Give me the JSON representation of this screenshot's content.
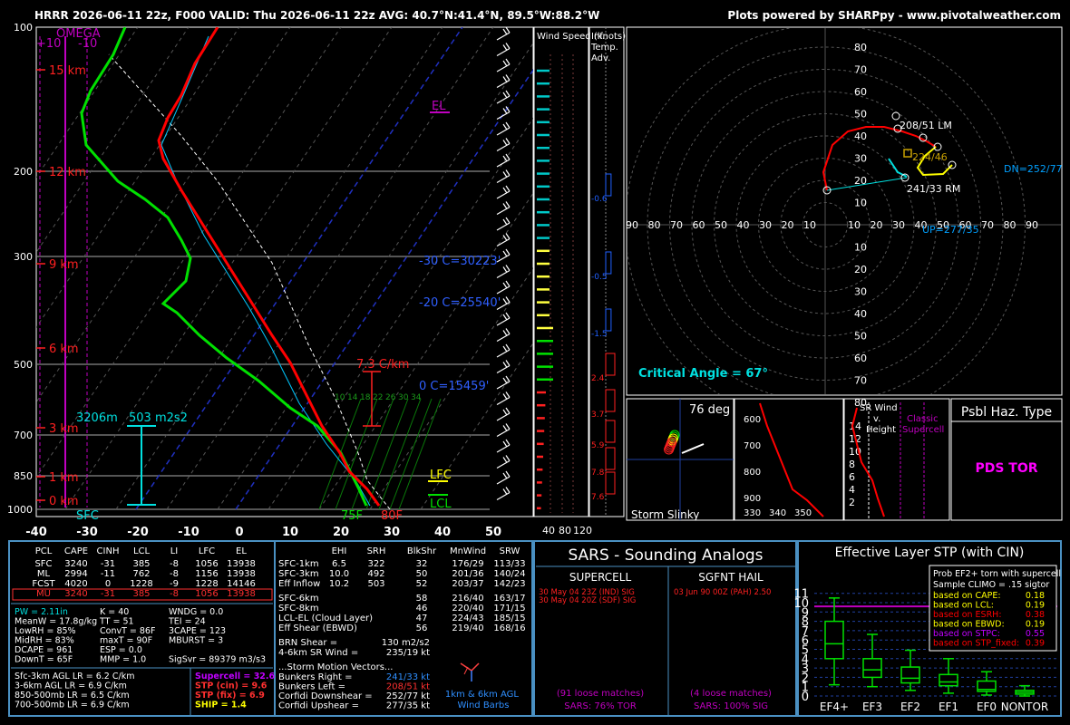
{
  "header": {
    "title": "HRRR 2026-06-11 22z, F000  VALID: Thu 2026-06-11 22z AVG: 40.7°N:41.4°N, 89.5°W:88.2°W",
    "credit": "Plots powered by SHARPpy - www.pivotalweather.com"
  },
  "skewt": {
    "pressure_ticks": [
      "100",
      "200",
      "300",
      "500",
      "700",
      "850",
      "1000"
    ],
    "temp_ticks": [
      "-40",
      "-30",
      "-20",
      "-10",
      "0",
      "10",
      "20",
      "30",
      "40",
      "50"
    ],
    "height_labels": [
      "15 km",
      "12 km",
      "9 km",
      "6 km",
      "3 km",
      "1 km",
      "0 km"
    ],
    "omega_label": "OMEGA",
    "omega_ticks": [
      "+10",
      "-10"
    ],
    "el_label": "EL",
    "lfc_label": "LFC",
    "lcl_label": "LCL",
    "lapse_label": "7.3 C/km",
    "iso_labels": [
      "-30 C=30223'",
      "-20 C=25540'",
      "0 C=15459'"
    ],
    "mix_labels": [
      "10",
      "14",
      "18",
      "22",
      "26",
      "30",
      "34"
    ],
    "srh_depth": "3206m",
    "srh_value": "503 m2s2",
    "sfc_label": "SFC",
    "sfc_td": "75F",
    "sfc_t": "80F",
    "colors": {
      "temp": "#ff0000",
      "dewpoint": "#00e000",
      "wetbulb": "#00c8ff",
      "parcel": "#ffffff",
      "omega": "#c000c0"
    }
  },
  "wind_speed_panel": {
    "title": "Wind Speed\n(knots)",
    "ticks": [
      "40",
      "80",
      "120"
    ]
  },
  "inf_panel": {
    "title": "Inf.\nTemp.\nAdv.",
    "values": [
      "-0.6",
      "-0.5",
      "-1.5",
      "2.4",
      "3.7",
      "5.9",
      "7.8",
      "7.6"
    ]
  },
  "hodograph": {
    "rings": [
      "10",
      "20",
      "30",
      "40",
      "50",
      "60",
      "70",
      "80"
    ],
    "x_ticks": [
      "90",
      "80",
      "70",
      "60",
      "50",
      "40",
      "30",
      "20",
      "10",
      "",
      "10",
      "20",
      "30",
      "40",
      "50",
      "60",
      "70",
      "80",
      "90"
    ],
    "labels": {
      "lm": "208/51 LM",
      "rm": "241/33 RM",
      "mean": "224/46",
      "dn": "DN=252/77",
      "up": "UP=277/35"
    },
    "critical_angle": "Critical Angle = 67°"
  },
  "storm_slinky": {
    "title": "Storm Slinky",
    "deg": "76 deg",
    "height_ticks": [
      "600",
      "700",
      "800",
      "900"
    ],
    "temp_ticks": [
      "330",
      "340",
      "350"
    ]
  },
  "sr_wind": {
    "title": "SR Wind\nv.\nHeight",
    "y_ticks": [
      "14",
      "12",
      "10",
      "8",
      "6",
      "4",
      "2"
    ],
    "classic": "Classic\nSupercell"
  },
  "hazard": {
    "title": "Psbl Haz. Type",
    "value": "PDS TOR"
  },
  "parcels": {
    "headers": [
      "PCL",
      "CAPE",
      "CINH",
      "LCL",
      "LI",
      "LFC",
      "EL"
    ],
    "rows": [
      [
        "SFC",
        "3240",
        "-31",
        "385",
        "-8",
        "1056",
        "13938"
      ],
      [
        "ML",
        "2994",
        "-11",
        "762",
        "-8",
        "1156",
        "13938"
      ],
      [
        "FCST",
        "4020",
        "0",
        "1228",
        "-9",
        "1228",
        "14146"
      ],
      [
        "MU",
        "3240",
        "-31",
        "385",
        "-8",
        "1056",
        "13938"
      ]
    ]
  },
  "indices": [
    [
      "PW = 2.11in",
      "K = 40",
      "WNDG = 0.0"
    ],
    [
      "MeanW = 17.8g/kg",
      "TT = 51",
      "TEI = 24"
    ],
    [
      "LowRH = 85%",
      "ConvT = 86F",
      "3CAPE = 123"
    ],
    [
      "MidRH = 83%",
      "maxT = 90F",
      "MBURST = 3"
    ],
    [
      "DCAPE = 961",
      "ESP = 0.0",
      ""
    ],
    [
      "DownT = 65F",
      "MMP = 1.0",
      "SigSvr = 89379 m3/s3"
    ]
  ],
  "lapse_rates": [
    "Sfc-3km AGL LR = 6.2 C/km",
    "3-6km AGL LR = 6.9 C/km",
    "850-500mb LR = 6.5 C/km",
    "700-500mb LR = 6.9 C/km"
  ],
  "composites": [
    "Supercell = 32.6",
    "STP (cin) = 9.6",
    "STP (fix) = 6.9",
    "SHIP = 1.4"
  ],
  "kinematics": {
    "headers": [
      "EHI",
      "SRH",
      "BlkShr",
      "MnWind",
      "SRW"
    ],
    "rows": [
      [
        "SFC-1km",
        "6.5",
        "322",
        "32",
        "176/29",
        "113/33"
      ],
      [
        "SFC-3km",
        "10.0",
        "492",
        "50",
        "201/36",
        "140/24"
      ],
      [
        "Eff Inflow",
        "10.2",
        "503",
        "52",
        "203/37",
        "142/23"
      ],
      [
        "SFC-6km",
        "",
        "",
        "58",
        "216/40",
        "163/17"
      ],
      [
        "SFC-8km",
        "",
        "",
        "46",
        "220/40",
        "171/15"
      ],
      [
        "LCL-EL (Cloud Layer)",
        "",
        "",
        "47",
        "224/43",
        "185/15"
      ],
      [
        "Eff Shear (EBWD)",
        "",
        "",
        "56",
        "219/40",
        "168/16"
      ]
    ],
    "brn_shear": "BRN Shear =",
    "brn_value": "130 m2/s2",
    "sr_wind_46": "4-6km SR Wind =",
    "sr_wind_46_value": "235/19 kt",
    "storm_motion_title": "...Storm Motion Vectors...",
    "motions": [
      [
        "Bunkers Right =",
        "241/33 kt"
      ],
      [
        "Bunkers Left =",
        "208/51 kt"
      ],
      [
        "Corfidi Downshear =",
        "252/77 kt"
      ],
      [
        "Corfidi Upshear =",
        "277/35 kt"
      ]
    ],
    "barb_caption": "1km & 6km AGL\nWind Barbs"
  },
  "sars": {
    "title": "SARS - Sounding Analogs",
    "supercell_title": "SUPERCELL",
    "hail_title": "SGFNT HAIL",
    "supercell_matches": [
      "30 May 04 23Z (IND)   SIG",
      "30 May 04 20Z (SDF)   SIG"
    ],
    "hail_matches": [
      "03 Jun 90 00Z (PAH)     2.50"
    ],
    "supercell_loose": "(91 loose matches)",
    "supercell_pct": "SARS: 76% TOR",
    "hail_loose": "(4 loose matches)",
    "hail_pct": "SARS: 100% SIG"
  },
  "stp": {
    "title": "Effective Layer STP (with CIN)",
    "y_ticks": [
      "0",
      "1",
      "2",
      "3",
      "4",
      "5",
      "6",
      "7",
      "8",
      "9",
      "10",
      "11"
    ],
    "categories": [
      "EF4+",
      "EF3",
      "EF2",
      "EF1",
      "EF0",
      "NONTOR"
    ],
    "box_values": [
      [
        1.2,
        4.0,
        5.6,
        8.0,
        10.5
      ],
      [
        1.0,
        2.0,
        2.8,
        4.0,
        6.6
      ],
      [
        0.6,
        1.4,
        1.9,
        3.1,
        4.9
      ],
      [
        0.3,
        1.1,
        1.5,
        2.3,
        4.0
      ],
      [
        0.1,
        0.5,
        0.7,
        1.6,
        2.6
      ],
      [
        0.0,
        0.2,
        0.4,
        0.6,
        1.1
      ]
    ],
    "current_value": 9.6,
    "prob_title": "Prob EF2+ torn with supercell",
    "prob_sub": "Sample CLIMO = .15 sigtor",
    "prob_rows": [
      [
        "based on CAPE:",
        "0.18",
        "#ffff00"
      ],
      [
        "based on LCL:",
        "0.19",
        "#ffff00"
      ],
      [
        "based on ESRH:",
        "0.38",
        "#ff0000"
      ],
      [
        "based on EBWD:",
        "0.19",
        "#ffff00"
      ],
      [
        "based on STPC:",
        "0.55",
        "#c000ff"
      ],
      [
        "based on STP_fixed:",
        "0.39",
        "#ff0000"
      ]
    ]
  }
}
